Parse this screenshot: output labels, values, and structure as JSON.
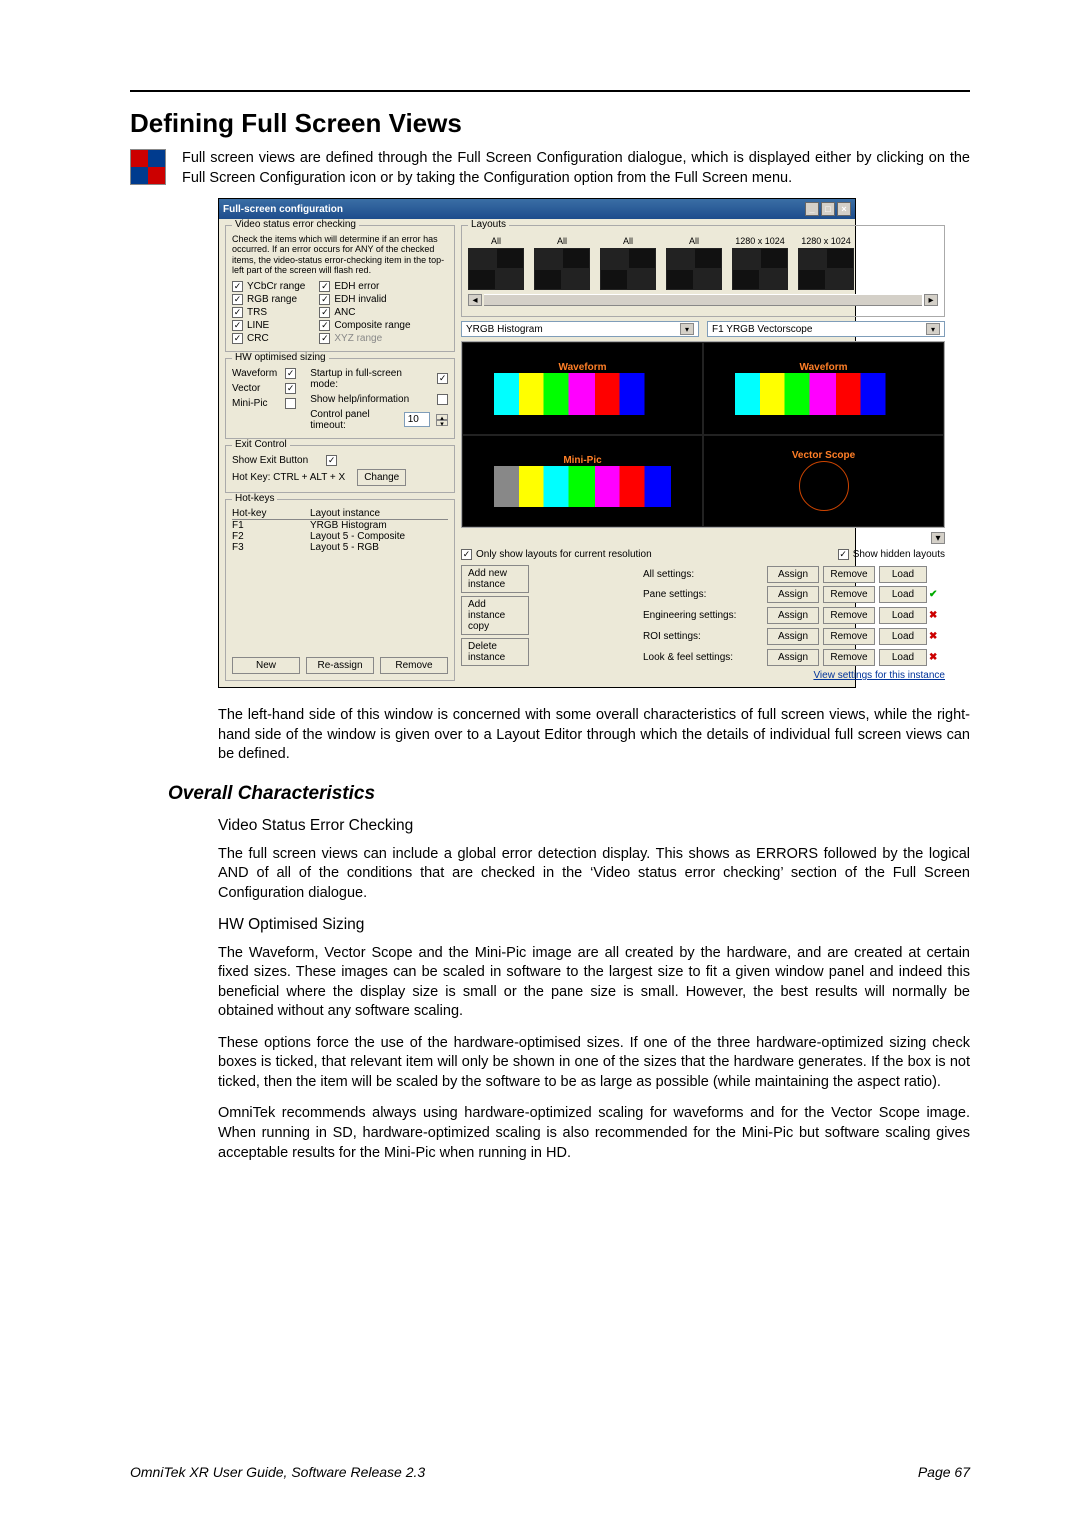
{
  "heading": "Defining Full Screen Views",
  "intro": "Full screen views are defined through the Full Screen Configuration dialogue, which is displayed either by clicking on the Full Screen Configuration icon or by taking the Configuration option from the Full Screen menu.",
  "after_shot": "The left-hand side of this window is concerned with some overall characteristics of full screen views, while the right-hand side of the window is given over to a Layout Editor through which the details of individual full screen views can be defined.",
  "h2": "Overall Characteristics",
  "sec1": {
    "title": "Video Status Error Checking",
    "p": "The full screen views can include a global error detection display. This shows as ERRORS followed by the logical AND of all of the conditions that are checked in the ‘Video status error checking’ section of the Full Screen Configuration dialogue."
  },
  "sec2": {
    "title": "HW Optimised Sizing",
    "p1": "The Waveform, Vector Scope and the Mini-Pic image are all created by the hardware, and are created at certain fixed sizes. These images can be scaled in software to the largest size to fit a given window panel and indeed this beneficial where the display size is small or the pane size is small. However, the best results will normally be obtained without any software scaling.",
    "p2": "These options force the use of the hardware-optimised sizes. If one of the three hardware-optimized sizing check boxes is ticked, that relevant item will only be shown in one of the sizes that the hardware generates. If the box is not ticked, then the item will be scaled by the software to be as large as possible (while maintaining the aspect ratio).",
    "p3": "OmniTek recommends always using hardware-optimized scaling for waveforms and for the Vector Scope image. When running in SD, hardware-optimized scaling is also recommended for the Mini-Pic but software scaling gives acceptable results for the Mini-Pic when running in HD."
  },
  "footer": {
    "left": "OmniTek XR User Guide, Software Release 2.3",
    "right": "Page 67"
  },
  "dlg": {
    "title": "Full-screen configuration",
    "group_video_status": "Video status error checking",
    "help_text": "Check the items which will determine if an error has occurred.  If an error occurs for ANY of the checked items, the video-status error-checking item in the top-left part of the screen will flash red.",
    "checks_left": [
      "YCbCr range",
      "RGB range",
      "TRS",
      "LINE",
      "CRC"
    ],
    "checks_right": [
      "EDH error",
      "EDH invalid",
      "ANC",
      "Composite range",
      "XYZ range"
    ],
    "group_hw": "HW optimised sizing",
    "hw_items": [
      "Waveform",
      "Vector",
      "Mini-Pic"
    ],
    "startup_label": "Startup in full-screen mode:",
    "showhelp_label": "Show help/information",
    "cp_timeout_label": "Control panel timeout:",
    "cp_timeout_value": "10",
    "group_exit": "Exit Control",
    "show_exit_label": "Show Exit Button",
    "hotkey_label": "Hot Key: CTRL + ALT + X",
    "change_btn": "Change",
    "group_hotkeys": "Hot-keys",
    "hk_head_1": "Hot-key",
    "hk_head_2": "Layout instance",
    "hk_rows": [
      {
        "k": "F1",
        "v": "YRGB Histogram"
      },
      {
        "k": "F2",
        "v": "Layout 5 - Composite"
      },
      {
        "k": "F3",
        "v": "Layout 5 - RGB"
      }
    ],
    "new_btn": "New",
    "reassign_btn": "Re-assign",
    "remove_btn": "Remove",
    "group_layouts": "Layouts",
    "thumb_labels": [
      "All",
      "All",
      "All",
      "All",
      "1280 x 1024",
      "1280 x 1024"
    ],
    "dd_left": "YRGB Histogram",
    "dd_right": "F1  YRGB Vectorscope",
    "preview_cells": [
      "Waveform",
      "Waveform",
      "Mini-Pic",
      "Vector Scope"
    ],
    "only_show_label": "Only show layouts for current resolution",
    "show_hidden_label": "Show hidden layouts",
    "left_btns": [
      "Add new instance",
      "Add instance copy",
      "Delete instance"
    ],
    "settings_labels": [
      "All settings:",
      "Pane settings:",
      "Engineering settings:",
      "ROI settings:",
      "Look & feel settings:"
    ],
    "assign": "Assign",
    "remove": "Remove",
    "load": "Load",
    "view_settings": "View settings for this instance"
  }
}
